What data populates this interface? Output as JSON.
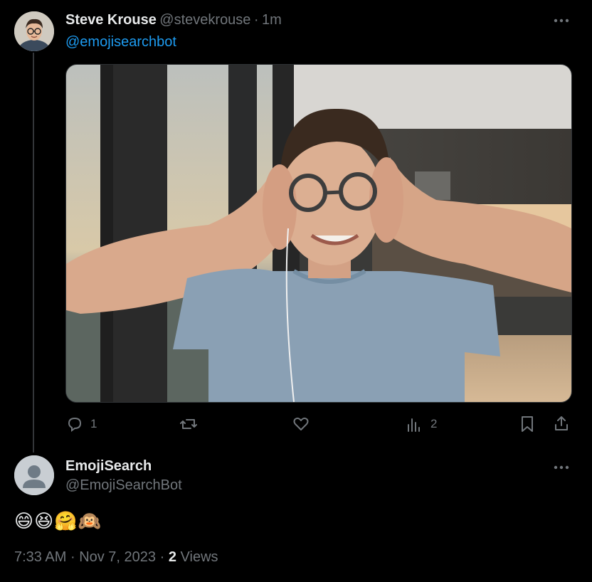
{
  "tweet": {
    "author_name": "Steve Krouse",
    "author_handle": "@stevekrouse",
    "separator": "·",
    "time_ago": "1m",
    "text": "@emojisearchbot",
    "actions": {
      "replies": "1",
      "views": "2"
    }
  },
  "reply": {
    "author_name": "EmojiSearch",
    "author_handle": "@EmojiSearchBot",
    "emojis": "😄😆🤗🙉",
    "time": "7:33 AM",
    "date": "Nov 7, 2023",
    "views_count": "2",
    "views_label": "Views"
  },
  "colors": {
    "accent": "#1d9bf0",
    "muted": "#71767b",
    "text": "#e7e9ea",
    "background": "#000000"
  },
  "icons": [
    "more-icon",
    "reply-icon",
    "retweet-icon",
    "like-icon",
    "views-icon",
    "bookmark-icon",
    "share-icon",
    "default-avatar-icon"
  ]
}
